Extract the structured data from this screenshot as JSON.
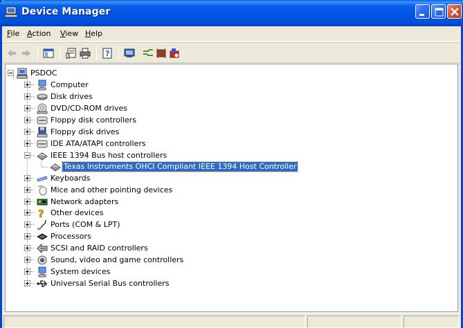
{
  "window": {
    "title": "Device Manager",
    "accent_color": "#0054e3",
    "controls": [
      "minimize-icon",
      "maximize-icon",
      "close-icon"
    ]
  },
  "menu": {
    "file": "File",
    "action": "Action",
    "view": "View",
    "help": "Help"
  },
  "toolbar": {
    "buttons": [
      "back-arrow-icon",
      "forward-arrow-icon",
      "show-hide-console-tree-icon",
      "properties-icon",
      "print-icon",
      "help-icon",
      "scan-hardware-icon",
      "update-driver-icon",
      "uninstall-icon",
      "disable-icon"
    ]
  },
  "tree": {
    "root": "PSDOC",
    "categories": [
      {
        "label": "Computer",
        "icon": "computer-icon",
        "expanded": false
      },
      {
        "label": "Disk drives",
        "icon": "disk-drive-icon",
        "expanded": false
      },
      {
        "label": "DVD/CD-ROM drives",
        "icon": "dvd-drive-icon",
        "expanded": false
      },
      {
        "label": "Floppy disk controllers",
        "icon": "floppy-controller-icon",
        "expanded": false
      },
      {
        "label": "Floppy disk drives",
        "icon": "floppy-drive-icon",
        "expanded": false
      },
      {
        "label": "IDE ATA/ATAPI controllers",
        "icon": "ide-controller-icon",
        "expanded": false
      },
      {
        "label": "IEEE 1394 Bus host controllers",
        "icon": "ieee1394-icon",
        "expanded": true
      },
      {
        "label": "Keyboards",
        "icon": "keyboard-icon",
        "expanded": false
      },
      {
        "label": "Mice and other pointing devices",
        "icon": "mouse-icon",
        "expanded": false
      },
      {
        "label": "Network adapters",
        "icon": "network-adapter-icon",
        "expanded": false
      },
      {
        "label": "Other devices",
        "icon": "unknown-device-icon",
        "expanded": false
      },
      {
        "label": "Ports (COM & LPT)",
        "icon": "port-icon",
        "expanded": false
      },
      {
        "label": "Processors",
        "icon": "processor-icon",
        "expanded": false
      },
      {
        "label": "SCSI and RAID controllers",
        "icon": "scsi-controller-icon",
        "expanded": false
      },
      {
        "label": "Sound, video and game controllers",
        "icon": "sound-icon",
        "expanded": false
      },
      {
        "label": "System devices",
        "icon": "system-device-icon",
        "expanded": false
      },
      {
        "label": "Universal Serial Bus controllers",
        "icon": "usb-icon",
        "expanded": false
      }
    ],
    "selected_child": "Texas Instruments OHCI Compliant IEEE 1394 Host Controller",
    "selected_color": "#316ac5"
  }
}
